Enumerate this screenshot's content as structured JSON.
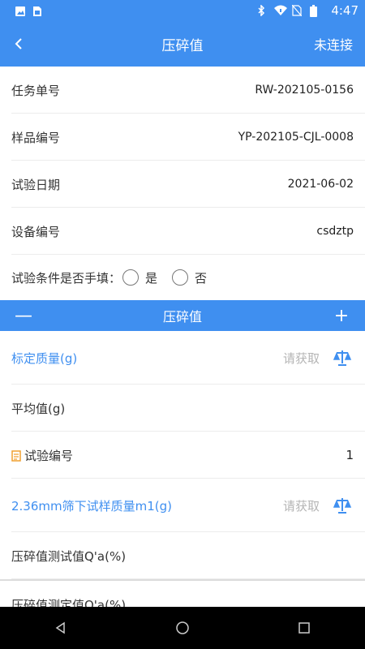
{
  "status_bar": {
    "time": "4:47",
    "left_icons": [
      "image-icon",
      "sim-icon"
    ],
    "right_icons": [
      "bluetooth-icon",
      "wifi-icon",
      "no-sim-icon",
      "battery-icon"
    ]
  },
  "header": {
    "title": "压碎值",
    "back_icon": "back-arrow-icon",
    "connection_status": "未连接"
  },
  "info": {
    "task_no": {
      "label": "任务单号",
      "value": "RW-202105-0156"
    },
    "sample_no": {
      "label": "样品编号",
      "value": "YP-202105-CJL-0008"
    },
    "test_date": {
      "label": "试验日期",
      "value": "2021-06-02"
    },
    "device_no": {
      "label": "设备编号",
      "value": "csdztp"
    },
    "manual_condition": {
      "label": "试验条件是否手填：",
      "yes": "是",
      "no": "否"
    }
  },
  "section": {
    "title": "压碎值",
    "collapse_label": "—",
    "add_label": "+"
  },
  "fields": {
    "calibration_mass": {
      "label": "标定质量(g)",
      "placeholder": "请获取",
      "icon": "scale-icon"
    },
    "average": {
      "label": "平均值(g)"
    },
    "test_no": {
      "label": "试验编号",
      "value": "1",
      "icon": "document-icon"
    },
    "sieve_mass": {
      "label": "2.36mm筛下试样质量m1(g)",
      "placeholder": "请获取",
      "icon": "scale-icon"
    },
    "crush_test_value": {
      "label": "压碎值测试值Q'a(%)"
    },
    "crush_measured_value": {
      "label": "压碎值测定值Q'a(%)"
    }
  },
  "colors": {
    "primary": "#3f8ff0",
    "placeholder": "#b5b5b5",
    "divider": "#ececec"
  },
  "nav_bar": {
    "icons": [
      "back-triangle-icon",
      "home-circle-icon",
      "recents-square-icon"
    ]
  }
}
